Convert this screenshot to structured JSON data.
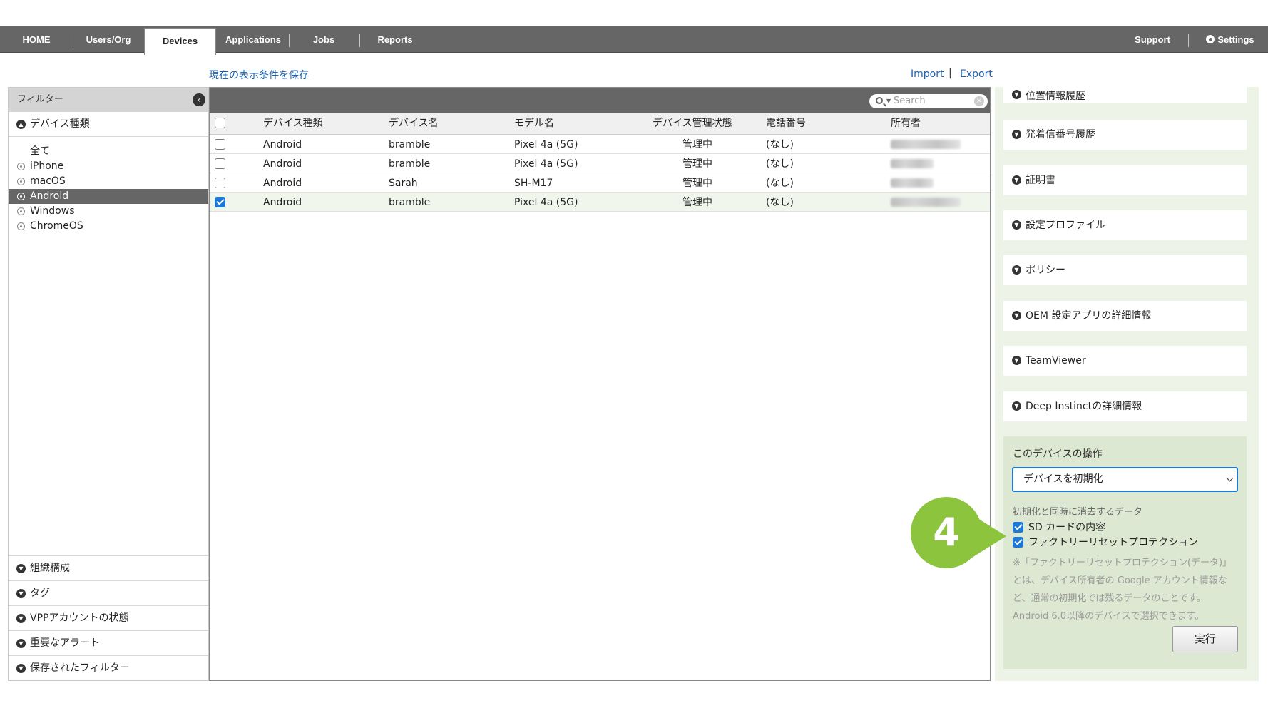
{
  "nav": {
    "items": [
      "HOME",
      "Users/Org",
      "Devices",
      "Applications",
      "Jobs",
      "Reports"
    ],
    "active": "Devices",
    "support": "Support",
    "settings": "Settings"
  },
  "save_link": "現在の表示条件を保存",
  "import": "Import",
  "export_sep": "|",
  "export": "Export",
  "sidebar": {
    "header": "フィルター",
    "device_type_label": "デバイス種類",
    "filters": [
      "全て",
      "iPhone",
      "macOS",
      "Android",
      "Windows",
      "ChromeOS"
    ],
    "selected": "Android",
    "bottom_sections": [
      "組織構成",
      "タグ",
      "VPPアカウントの状態",
      "重要なアラート",
      "保存されたフィルター"
    ]
  },
  "search": {
    "placeholder": "Search"
  },
  "table": {
    "headers": [
      "デバイス種類",
      "デバイス名",
      "モデル名",
      "デバイス管理状態",
      "電話番号",
      "所有者"
    ],
    "rows": [
      {
        "type": "Android",
        "name": "bramble",
        "model": "Pixel 4a (5G)",
        "status": "管理中",
        "phone": "(なし)",
        "checked": false
      },
      {
        "type": "Android",
        "name": "bramble",
        "model": "Pixel 4a (5G)",
        "status": "管理中",
        "phone": "(なし)",
        "checked": false
      },
      {
        "type": "Android",
        "name": "Sarah",
        "model": "SH-M17",
        "status": "管理中",
        "phone": "(なし)",
        "checked": false
      },
      {
        "type": "Android",
        "name": "bramble",
        "model": "Pixel 4a (5G)",
        "status": "管理中",
        "phone": "(なし)",
        "checked": true
      }
    ]
  },
  "right_panel": {
    "sections": [
      "位置情報履歴",
      "発着信番号履歴",
      "証明書",
      "設定プロファイル",
      "ポリシー",
      "OEM 設定アプリの詳細情報",
      "TeamViewer",
      "Deep Instinctの詳細情報"
    ],
    "ops": {
      "title": "このデバイスの操作",
      "selected_action": "デバイスを初期化",
      "erase_label": "初期化と同時に消去するデータ",
      "options": [
        "SD カードの内容",
        "ファクトリーリセットプロテクション"
      ],
      "note": "※「ファクトリーリセットプロテクション(データ)」とは、デバイス所有者の Google アカウント情報など、通常の初期化では残るデータのことです。Android 6.0以降のデバイスで選択できます。",
      "execute": "実行"
    }
  },
  "step_badge": "4",
  "colors": {
    "nav_bg": "#666666",
    "accent": "#1e78d7",
    "badge": "#8cc43e",
    "ops_bg": "#dde8d2"
  }
}
